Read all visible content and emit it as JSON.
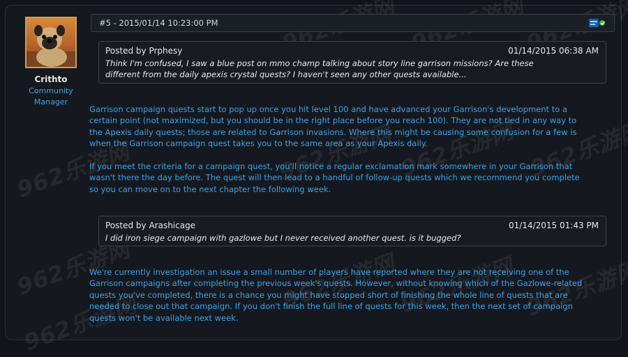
{
  "post": {
    "number_date": "#5 - 2015/01/14 10:23:00 PM",
    "icon": "blue-post-icon"
  },
  "user": {
    "name": "Crithto",
    "role_line1": "Community",
    "role_line2": "Manager",
    "avatar": "pug-avatar"
  },
  "quote1": {
    "author": "Posted by Prphesy",
    "date": "01/14/2015 06:38 AM",
    "text": "Think I'm confused, I saw a blue post on mmo champ talking about story line garrison missions? Are these\ndifferent from the daily apexis crystal quests? I haven't seen any other quests available..."
  },
  "reply1": {
    "para1": "Garrison campaign quests start to pop up once you hit level 100 and have advanced your Garrison's development to a\ncertain point (not maximized, but you should be in the right place before you reach 100). They are not tied in any way to\nthe Apexis daily quests; those are related to Garrison invasions. Where this might be causing some confusion for a few is\nwhen the Garrison campaign quest takes you to the same area as your Apexis daily.",
    "para2": "If you meet the criteria for a campaign quest, you'll notice a regular exclamation mark somewhere in your Garrison that\nwasn't there the day before. The quest will then lead to a handful of follow-up quests which we recommend you complete\nso you can move on to the next chapter the following week."
  },
  "quote2": {
    "author": "Posted by Arashicage",
    "date": "01/14/2015 01:43 PM",
    "text": "I did iron siege campaign with gazlowe but I never received another quest. is it bugged?"
  },
  "reply2": {
    "para1": "We're currently investigation an issue a small number of players have reported where they are not receiving one of the\nGarrison campaigns after completing the previous week's quests. However, without knowing which of the Gazlowe-related\nquests you've completed, there is a chance you might have stopped short of finishing the whole line of quests that are\nneeded to close out that campaign. If you don't finish the full line of quests for this week, then the next set of campaign\nquests won't be available next week."
  },
  "watermark": "962乐游网"
}
